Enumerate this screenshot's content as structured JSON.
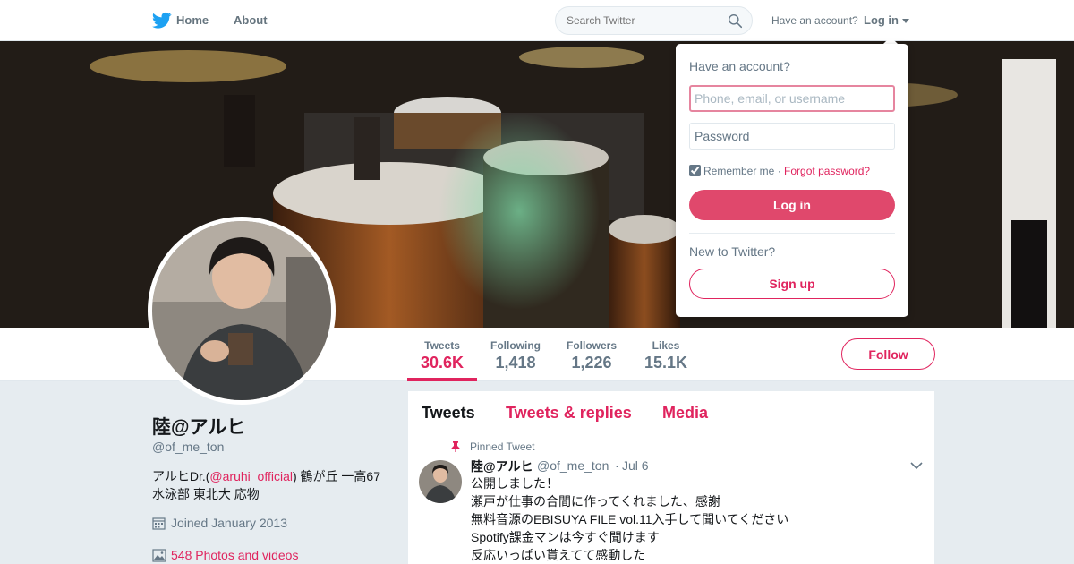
{
  "nav": {
    "home": "Home",
    "about": "About",
    "search_placeholder": "Search Twitter",
    "have_account": "Have an account?",
    "login": "Log in"
  },
  "profile": {
    "name": "陸@アルヒ",
    "handle": "@of_me_ton",
    "bio_prefix": "アルヒDr.(",
    "bio_link": "@aruhi_official",
    "bio_suffix": ") 鶴が丘 一高67",
    "bio_line2": "水泳部 東北大 応物",
    "joined": "Joined January 2013",
    "photos": "548 Photos and videos"
  },
  "stats": [
    {
      "label": "Tweets",
      "value": "30.6K"
    },
    {
      "label": "Following",
      "value": "1,418"
    },
    {
      "label": "Followers",
      "value": "1,226"
    },
    {
      "label": "Likes",
      "value": "15.1K"
    }
  ],
  "follow_label": "Follow",
  "timeline": {
    "tabs": [
      "Tweets",
      "Tweets & replies",
      "Media"
    ],
    "pinned_label": "Pinned Tweet",
    "tweet": {
      "name": "陸@アルヒ",
      "handle": "@of_me_ton",
      "dot": "·",
      "date": "Jul 6",
      "lines": [
        "公開しました！",
        "瀬戸が仕事の合間に作ってくれました、感謝",
        "無料音源のEBISUYA FILE vol.11入手して聞いてください",
        "Spotify課金マンは今すぐ聞けます",
        "反応いっぱい貰えてて感動した"
      ]
    }
  },
  "login_dropdown": {
    "title": "Have an account?",
    "username_placeholder": "Phone, email, or username",
    "password_placeholder": "Password",
    "remember": "Remember me",
    "separator": "·",
    "forgot": "Forgot password?",
    "login_button": "Log in",
    "new_to_twitter": "New to Twitter?",
    "signup_button": "Sign up"
  },
  "colors": {
    "accent": "#e0245e",
    "login_button": "#e0486c",
    "muted": "#657786",
    "background": "#e6ecf0"
  },
  "icons": [
    "twitter-bird-icon",
    "search-icon",
    "calendar-icon",
    "photo-icon",
    "pin-icon",
    "chevron-down-icon"
  ]
}
